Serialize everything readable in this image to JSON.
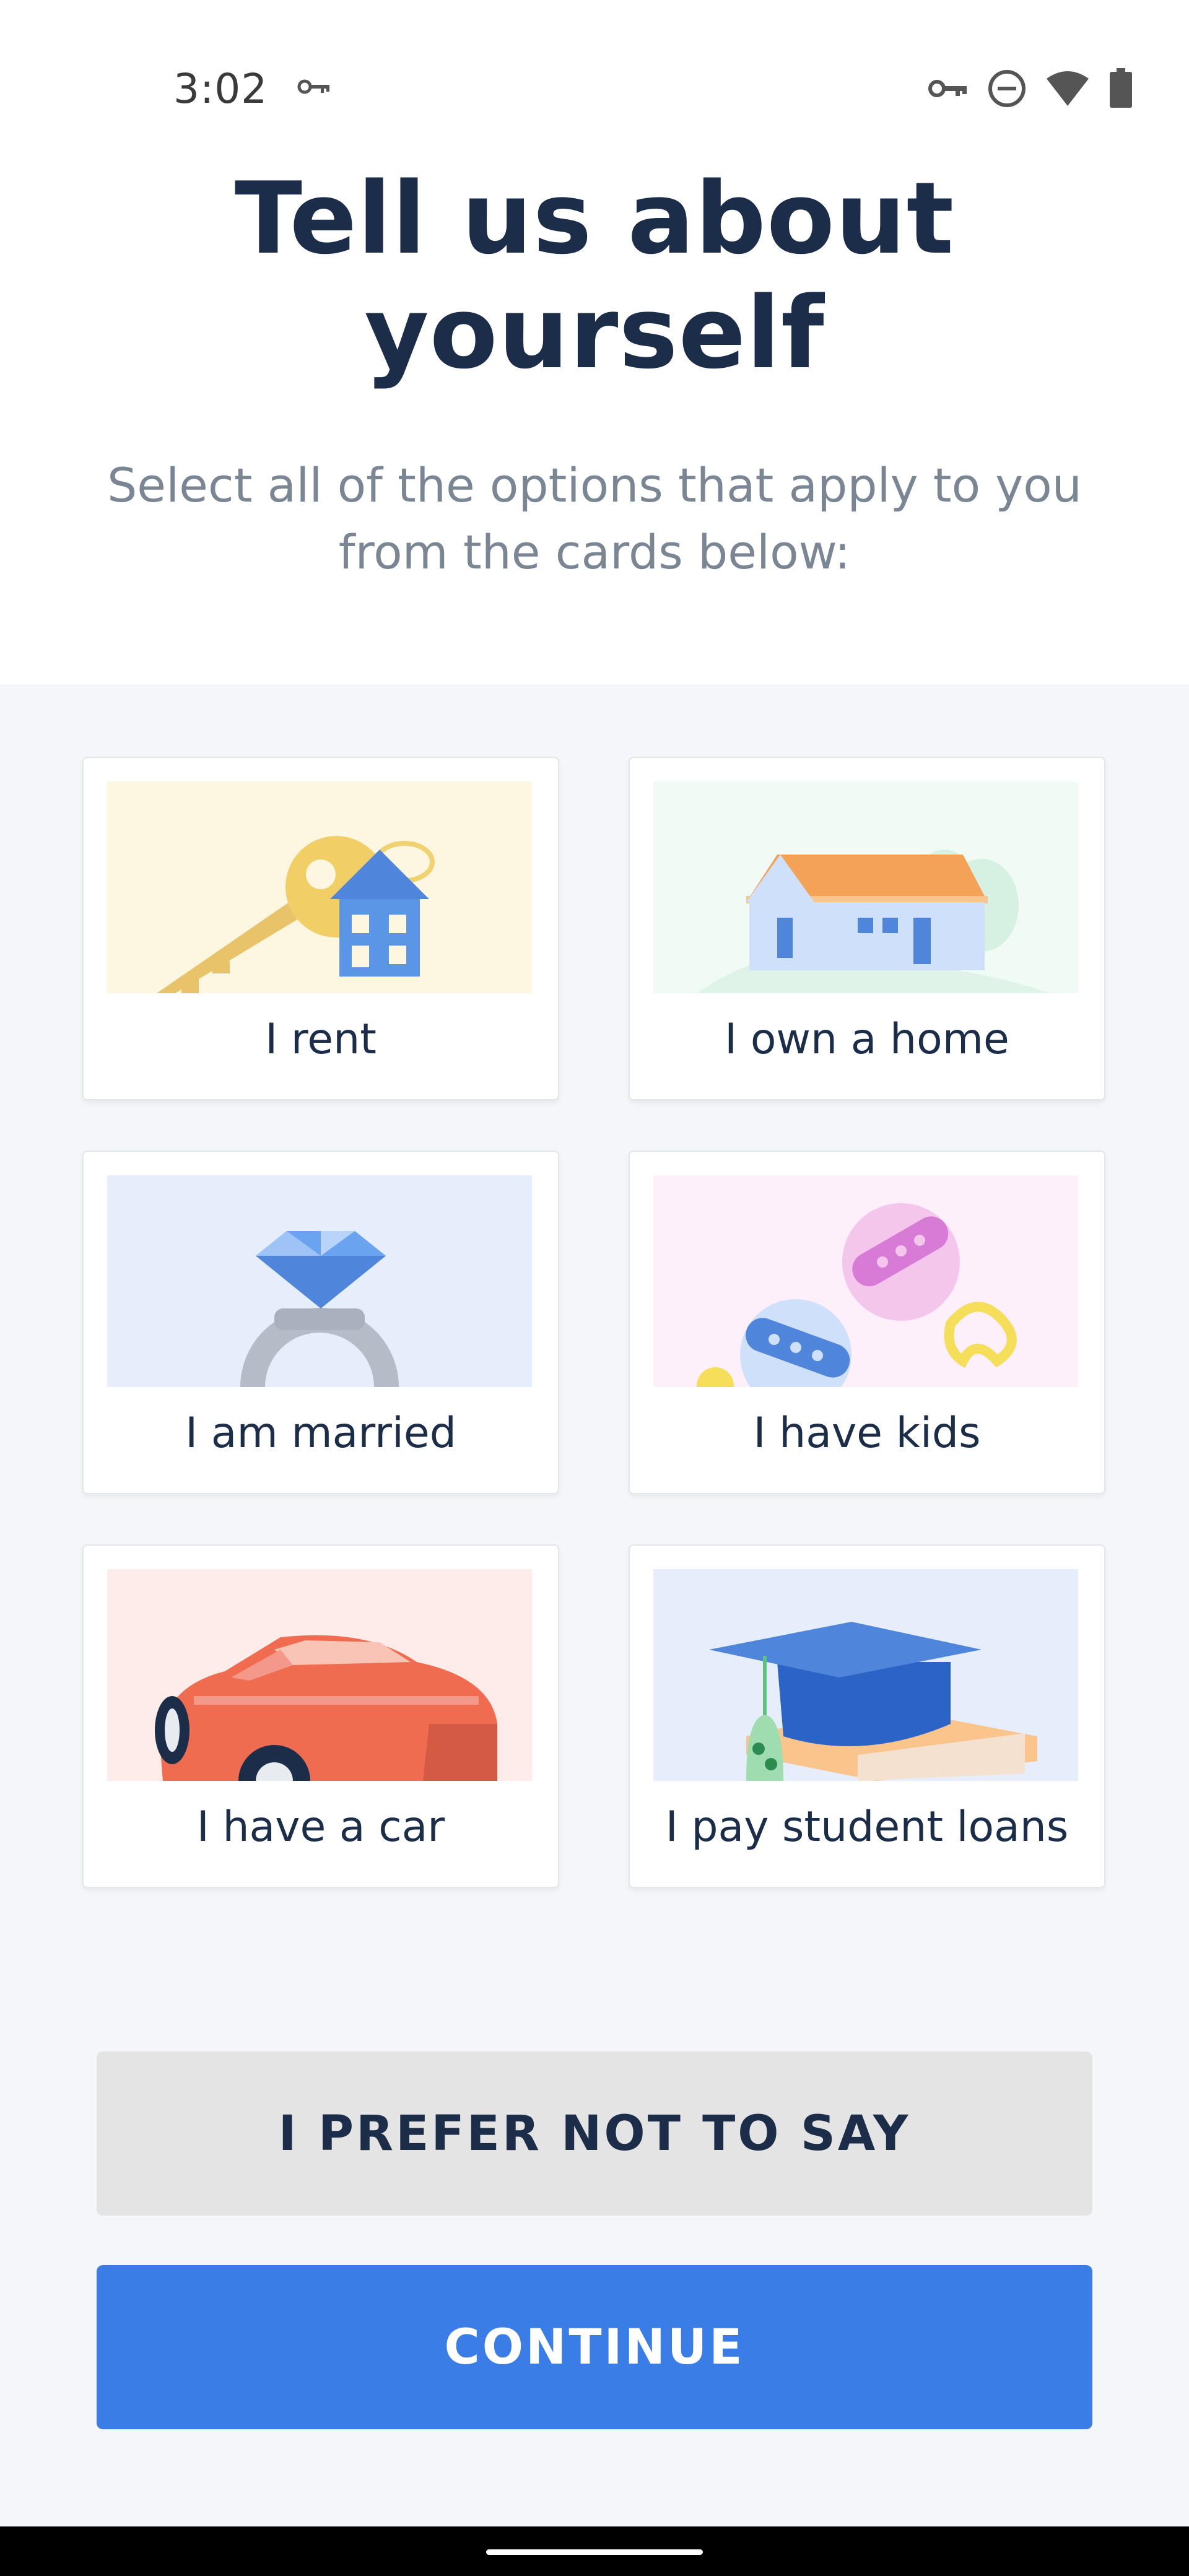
{
  "status_bar": {
    "time": "3:02",
    "icons": [
      "vpn-key-icon",
      "key-icon",
      "do-not-disturb-icon",
      "wifi-icon",
      "battery-icon"
    ]
  },
  "header": {
    "title_line1": "Tell us about",
    "title_line2": "yourself",
    "subtitle_line1": "Select all of the options that apply to you",
    "subtitle_line2": "from the cards below:"
  },
  "cards": [
    {
      "label": "I rent",
      "icon": "keys-house-icon",
      "bg": "#fdf6e1"
    },
    {
      "label": "I own a home",
      "icon": "house-icon",
      "bg": "#f0fbf6"
    },
    {
      "label": "I am married",
      "icon": "ring-icon",
      "bg": "#e6eefc"
    },
    {
      "label": "I have kids",
      "icon": "rattles-icon",
      "bg": "#fdf0fa"
    },
    {
      "label": "I have a car",
      "icon": "car-icon",
      "bg": "#fdece9"
    },
    {
      "label": "I pay student loans",
      "icon": "graduation-cap-icon",
      "bg": "#e6eefc"
    }
  ],
  "buttons": {
    "prefer_not": "I PREFER NOT TO SAY",
    "continue": "CONTINUE"
  },
  "colors": {
    "primary": "#3a7de6",
    "title": "#1c2d4a",
    "subtitle": "#7a8694",
    "secondary_button": "#e4e4e4",
    "content_bg": "#f4f6f9"
  }
}
